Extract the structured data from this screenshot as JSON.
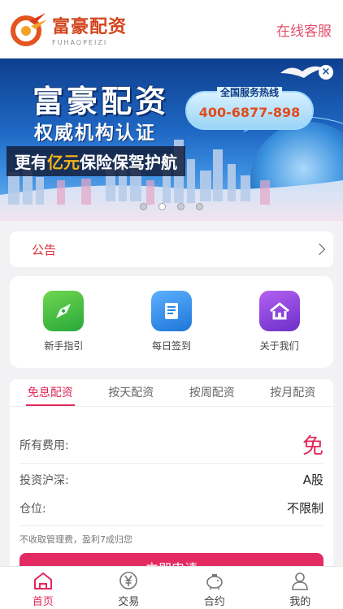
{
  "header": {
    "logo_title": "富豪配资",
    "logo_sub": "FUHAOPEIZI",
    "service_link": "在线客服"
  },
  "banner": {
    "title": "富豪配资",
    "subtitle": "权威机构认证",
    "slogan_prefix": "更有",
    "slogan_highlight": "亿元",
    "slogan_suffix": "保险保驾护航",
    "hotline_label": "全国服务热线",
    "hotline_number": "400-6877-898",
    "close_glyph": "×",
    "slide_count": 4,
    "active_slide": 1
  },
  "notice": {
    "label": "公告"
  },
  "quick_actions": [
    {
      "label": "新手指引",
      "icon": "compass-icon",
      "color": "#3cbc3f"
    },
    {
      "label": "每日签到",
      "icon": "book-icon",
      "color": "#2a86e6"
    },
    {
      "label": "关于我们",
      "icon": "home-icon",
      "color": "#8a3ede"
    }
  ],
  "product": {
    "tabs": [
      "免息配资",
      "按天配资",
      "按周配资",
      "按月配资"
    ],
    "active_tab": 0,
    "rows": [
      {
        "label": "所有费用:",
        "value": "免"
      },
      {
        "label": "投资沪深:",
        "value": "A股"
      },
      {
        "label": "仓位:",
        "value": "不限制"
      }
    ],
    "footnote": "不收取管理费，盈利7成归您",
    "apply_label": "立即申请"
  },
  "tabbar": {
    "items": [
      {
        "label": "首页",
        "icon": "home-icon",
        "active": true
      },
      {
        "label": "交易",
        "icon": "yen-icon",
        "active": false
      },
      {
        "label": "合约",
        "icon": "piggy-bank-icon",
        "active": false
      },
      {
        "label": "我的",
        "icon": "user-icon",
        "active": false
      }
    ]
  },
  "colors": {
    "accent": "#e2285a",
    "notice_red": "#d8323a",
    "service_pink": "#e0506a"
  }
}
